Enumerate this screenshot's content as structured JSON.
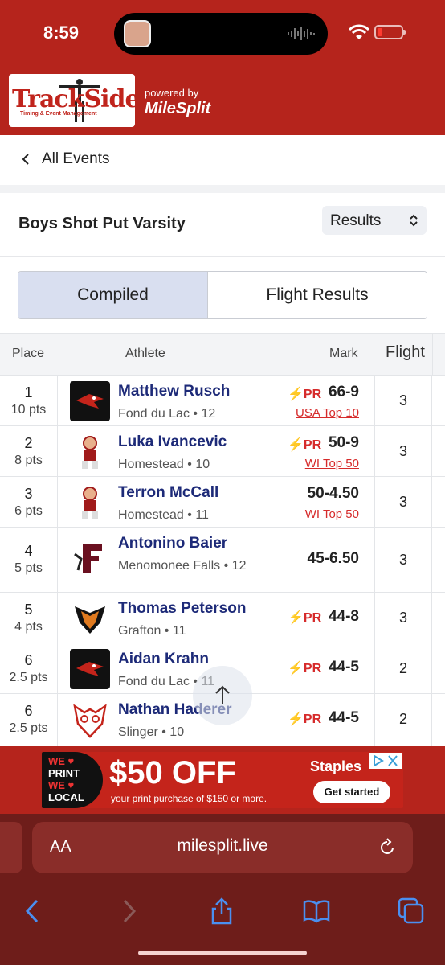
{
  "status_bar": {
    "time": "8:59"
  },
  "brand": {
    "logo_text": "TrackSide",
    "logo_sub": "Timing & Event Management",
    "powered_by": "powered by",
    "partner": "MileSplit"
  },
  "nav": {
    "back_label": "All Events"
  },
  "event": {
    "title": "Boys Shot Put Varsity",
    "view_select": "Results"
  },
  "tabs": [
    {
      "label": "Compiled",
      "active": true
    },
    {
      "label": "Flight Results",
      "active": false
    }
  ],
  "table": {
    "headers": {
      "place": "Place",
      "athlete": "Athlete",
      "mark": "Mark",
      "flight": "Flight"
    },
    "rows": [
      {
        "place": "1",
        "points": "10 pts",
        "name": "Matthew Rusch",
        "team": "Fond du Lac • 12",
        "pr": "PR",
        "mark": "66-9",
        "rank": "USA Top 10",
        "flight": "3",
        "logo": "fond-du-lac-logo"
      },
      {
        "place": "2",
        "points": "8 pts",
        "name": "Luka Ivancevic",
        "team": "Homestead • 10",
        "pr": "PR",
        "mark": "50-9",
        "rank": "WI Top 50",
        "flight": "3",
        "logo": "homestead-logo"
      },
      {
        "place": "3",
        "points": "6 pts",
        "name": "Terron McCall",
        "team": "Homestead • 11",
        "pr": "",
        "mark": "50-4.50",
        "rank": "WI Top 50",
        "flight": "3",
        "logo": "homestead-logo"
      },
      {
        "place": "4",
        "points": "5 pts",
        "name": "Antonino Baier",
        "team": "Menomonee Falls • 12",
        "pr": "",
        "mark": "45-6.50",
        "rank": "",
        "flight": "3",
        "logo": "menomonee-falls-logo"
      },
      {
        "place": "5",
        "points": "4 pts",
        "name": "Thomas Peterson",
        "team": "Grafton • 11",
        "pr": "PR",
        "mark": "44-8",
        "rank": "",
        "flight": "3",
        "logo": "grafton-logo"
      },
      {
        "place": "6",
        "points": "2.5 pts",
        "name": "Aidan Krahn",
        "team": "Fond du Lac • 11",
        "pr": "PR",
        "mark": "44-5",
        "rank": "",
        "flight": "2",
        "logo": "fond-du-lac-logo"
      },
      {
        "place": "6",
        "points": "2.5 pts",
        "name": "Nathan Haderer",
        "team": "Slinger • 10",
        "pr": "PR",
        "mark": "44-5",
        "rank": "",
        "flight": "2",
        "logo": "slinger-logo"
      }
    ]
  },
  "ad": {
    "badge_lines": [
      "WE ♥",
      "PRINT",
      "WE ♥",
      "LOCAL"
    ],
    "headline": "$50 OFF",
    "subtext": "your print purchase of $150 or more.",
    "brand": "Staples",
    "cta": "Get started"
  },
  "browser": {
    "text_size_label": "AA",
    "url": "milesplit.live"
  },
  "colors": {
    "brand_red": "#b5241c",
    "link_navy": "#1d2a78",
    "pr_red": "#d62b2b",
    "tab_active": "#d9dff0"
  }
}
